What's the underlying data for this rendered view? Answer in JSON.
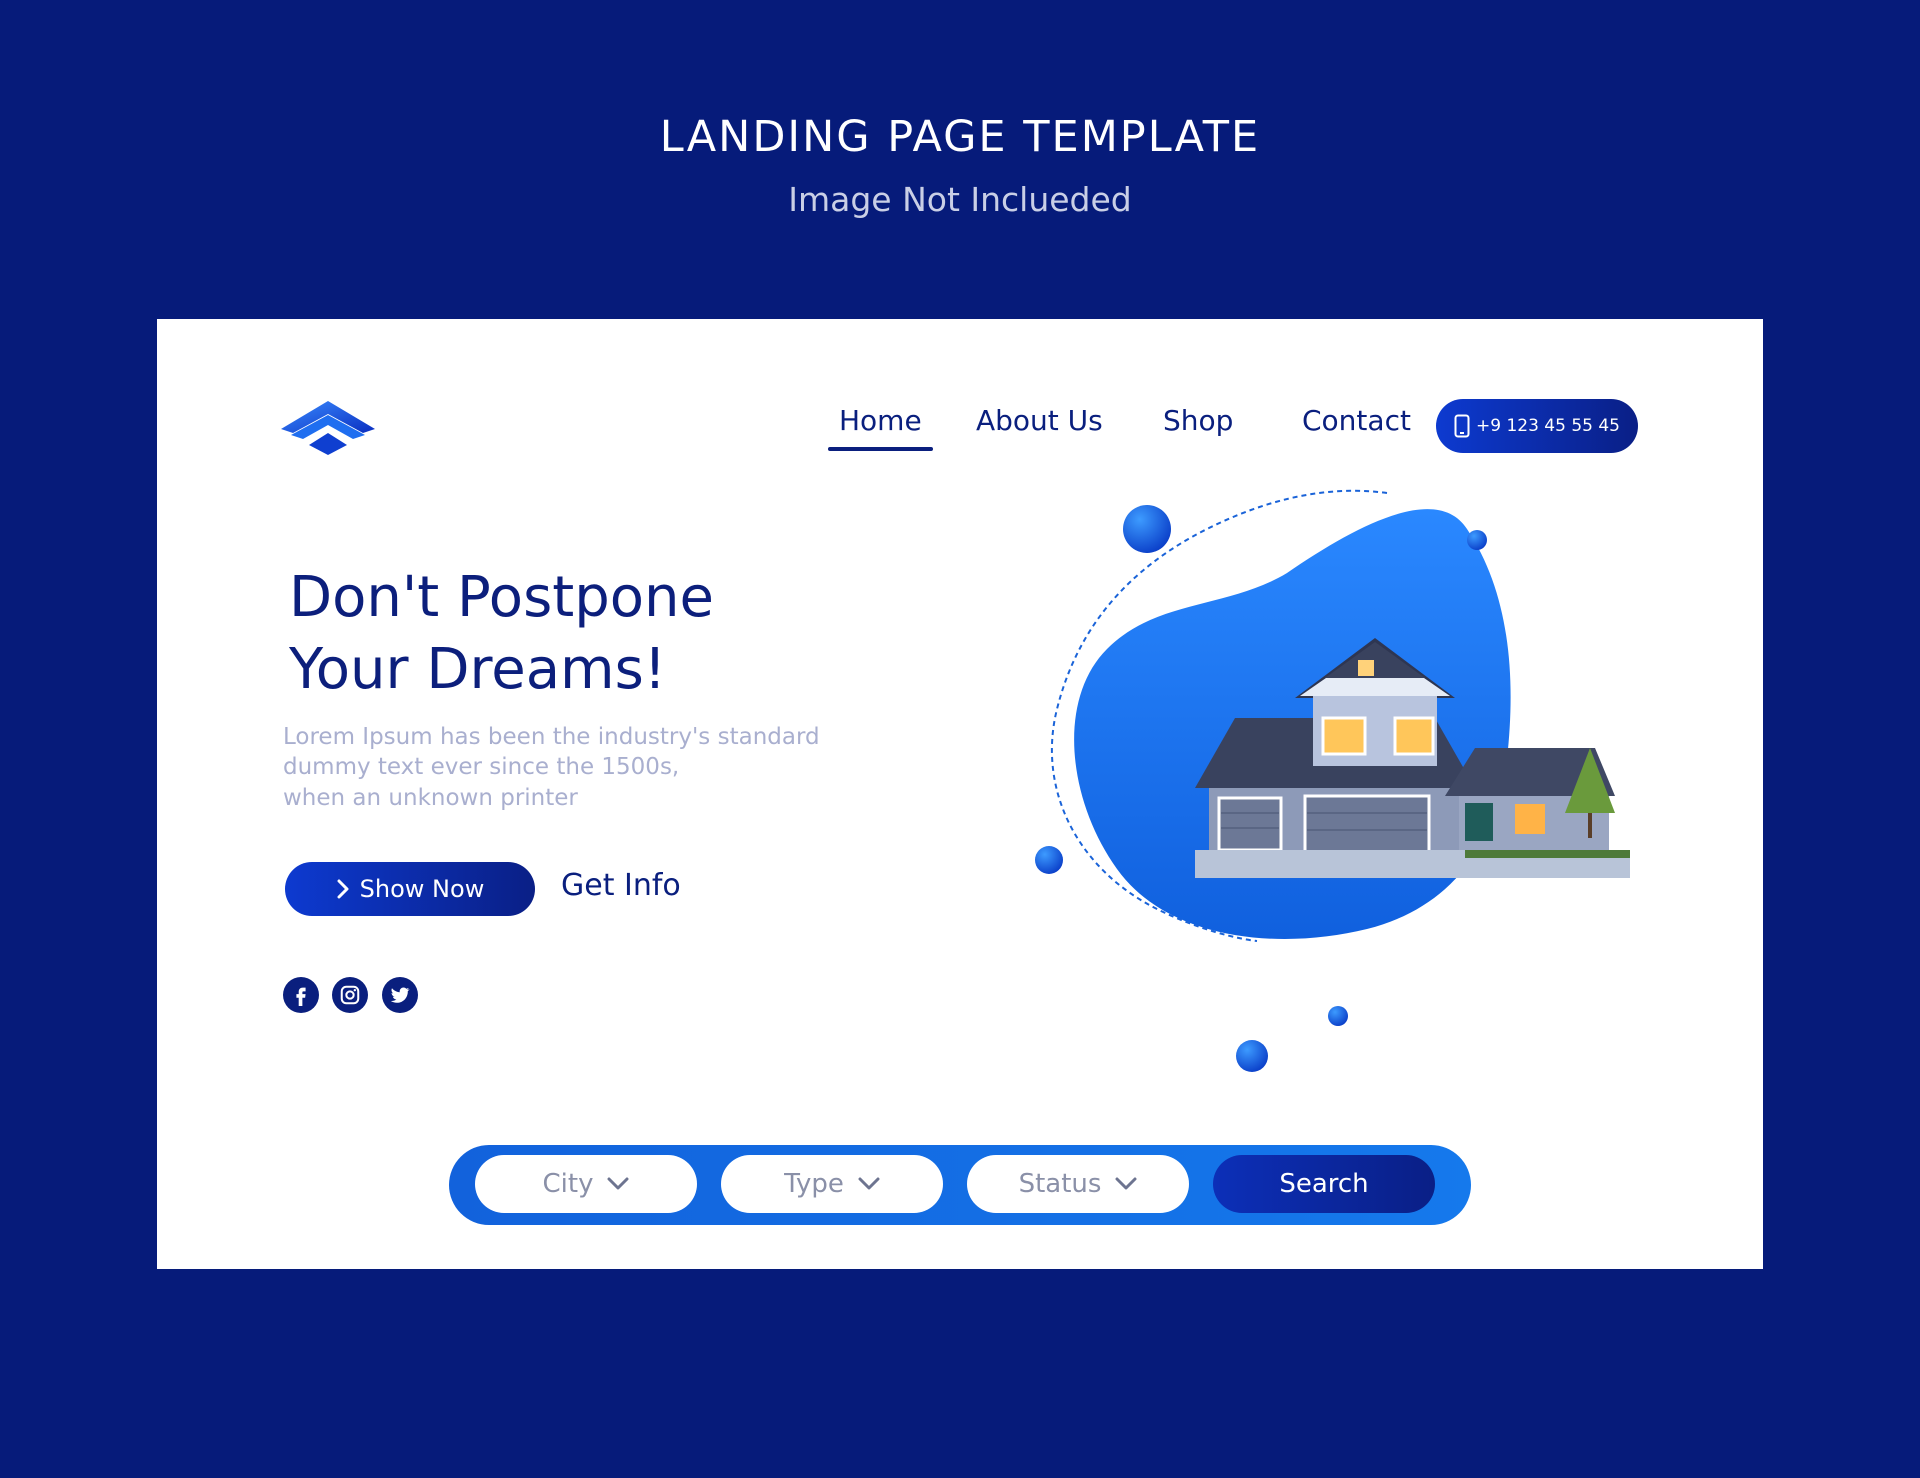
{
  "showcase": {
    "title": "LANDING PAGE TEMPLATE",
    "subtitle": "Image Not Inclueded"
  },
  "nav": {
    "items": [
      {
        "label": "Home",
        "active": true
      },
      {
        "label": "About Us"
      },
      {
        "label": "Shop"
      },
      {
        "label": "Contact"
      }
    ],
    "phone": "+9 123 45 55 45"
  },
  "hero": {
    "heading_line1": "Don't Postpone",
    "heading_line2": "Your Dreams!",
    "description_lines": [
      "Lorem Ipsum has been the industry's standard",
      "dummy text ever since the 1500s,",
      "when an unknown printer"
    ],
    "primary_button": "Show Now",
    "secondary_link": "Get Info"
  },
  "social_icons": [
    "facebook-icon",
    "instagram-icon",
    "twitter-icon"
  ],
  "search": {
    "filters": [
      {
        "label": "City"
      },
      {
        "label": "Type"
      },
      {
        "label": "Status"
      }
    ],
    "button": "Search"
  },
  "colors": {
    "background": "#061b7a",
    "primary_navy": "#0a1f7e",
    "accent_blue": "#1570e8",
    "muted_text": "#a9afcf"
  }
}
